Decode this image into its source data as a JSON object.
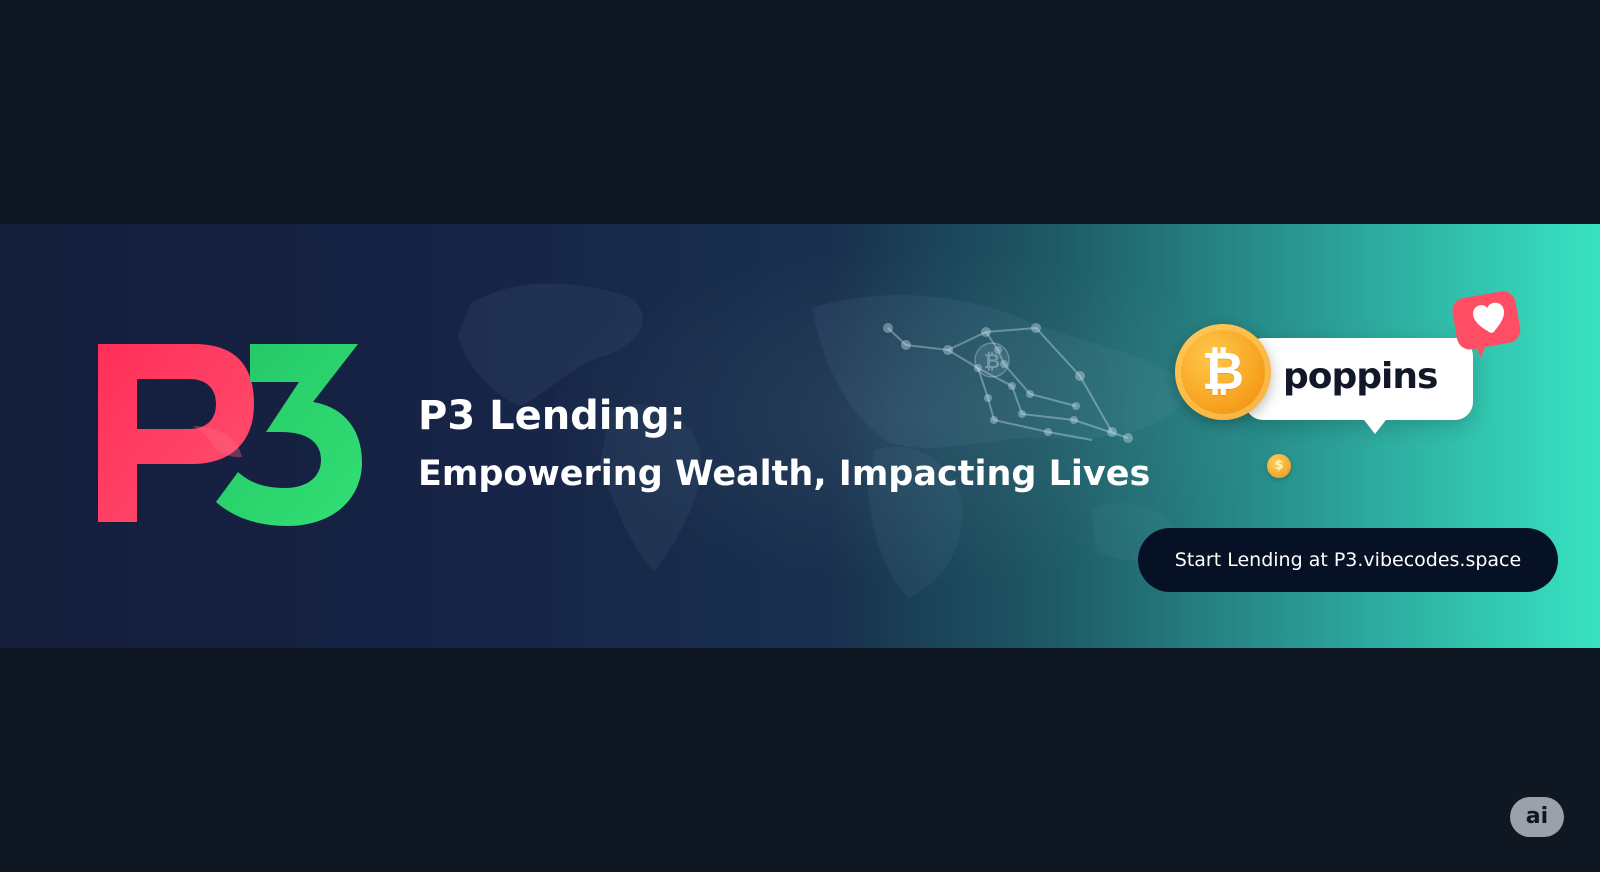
{
  "banner": {
    "logo_text": "P3",
    "title": "P3 Lending:",
    "tagline": "Empowering Wealth, Impacting Lives",
    "brand": {
      "name": "poppins",
      "coin_symbol": "₿",
      "small_coin_symbol": "$"
    },
    "cta_label": "Start Lending at P3.vibecodes.space"
  },
  "footer": {
    "badge": "ai"
  },
  "colors": {
    "background": "#0f1723",
    "banner_start": "#141d3a",
    "banner_end": "#38e3c2",
    "logo_p": "#ff315f",
    "logo_3": "#28d56b",
    "coin": "#f7a21f",
    "heart_tag": "#ff4d63",
    "cta": "#071126"
  },
  "icons": {
    "logo": "p3-logo-icon",
    "world_map": "world-map-icon",
    "coin": "bitcoin-coin-icon",
    "heart": "heart-icon"
  }
}
